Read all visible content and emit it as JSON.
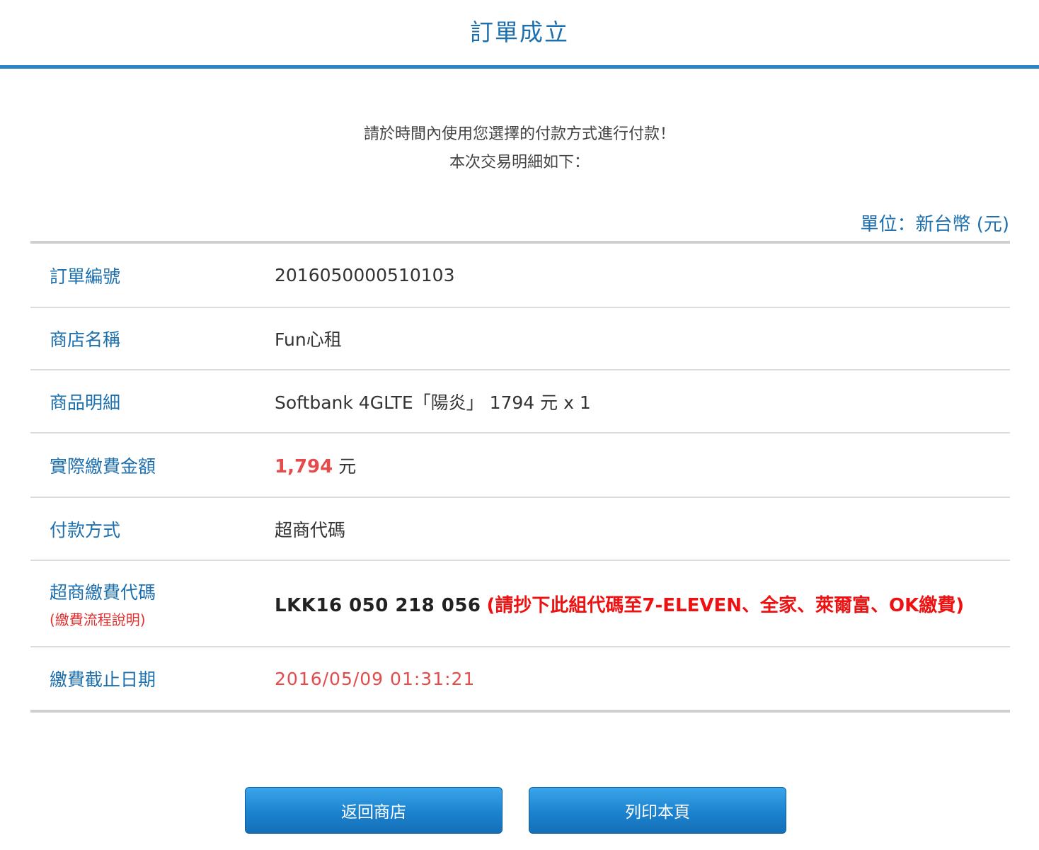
{
  "header": {
    "title": "訂單成立"
  },
  "intro": {
    "line1": "請於時間內使用您選擇的付款方式進行付款！",
    "line2": "本次交易明細如下："
  },
  "unit_label": "單位：新台幣 (元)",
  "details": {
    "order_no": {
      "label": "訂單編號",
      "value": "2016050000510103"
    },
    "store_name": {
      "label": "商店名稱",
      "value": "Fun心租"
    },
    "item_detail": {
      "label": "商品明細",
      "value": "Softbank 4GLTE「陽炎」 1794 元 x 1"
    },
    "amount": {
      "label": "實際繳費金額",
      "value": "1,794",
      "unit": "元"
    },
    "payment_method": {
      "label": "付款方式",
      "value": "超商代碼"
    },
    "payment_code": {
      "label": "超商繳費代碼",
      "sub_label": "(繳費流程說明)",
      "value": "LKK16 050 218 056",
      "note": "(請抄下此組代碼至7-ELEVEN、全家、萊爾富、OK繳費)"
    },
    "deadline": {
      "label": "繳費截止日期",
      "value": "2016/05/09 01:31:21"
    }
  },
  "buttons": {
    "back_label": "返回商店",
    "print_label": "列印本頁"
  },
  "colors": {
    "accent": "#1d6fae",
    "header_rule": "#2a84c6",
    "alert": "#e54b4b",
    "button": "#1c82cf"
  }
}
